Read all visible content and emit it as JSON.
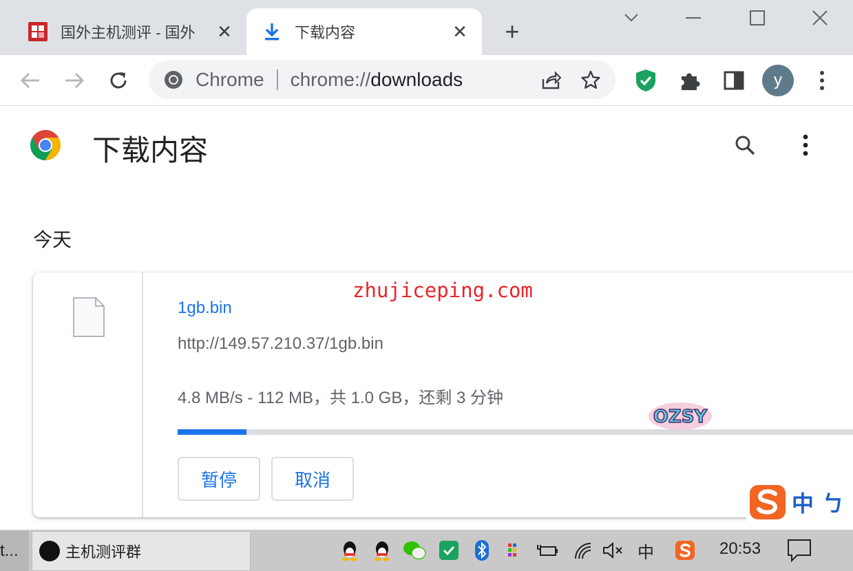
{
  "tabs": [
    {
      "title": "国外主机测评 - 国外",
      "close": "✕",
      "favicon": "zhujiceping-favicon"
    },
    {
      "title": "下载内容",
      "close": "✕",
      "favicon": "download-icon"
    }
  ],
  "new_tab_symbol": "+",
  "window_controls": [
    "tab-search-icon",
    "minimize-icon",
    "maximize-icon",
    "close-icon"
  ],
  "omnibox": {
    "scheme_label": "Chrome",
    "url_prefix": "chrome://",
    "url_host": "downloads"
  },
  "toolbar_icons": [
    "back-icon",
    "forward-icon",
    "reload-icon",
    "share-icon",
    "star-icon",
    "shield-extension-icon",
    "puzzle-extension-icon",
    "side-panel-icon",
    "menu-icon"
  ],
  "profile": {
    "initial": "y"
  },
  "page": {
    "title": "下载内容",
    "date_group": "今天"
  },
  "download": {
    "file_name": "1gb.bin",
    "url": "http://149.57.210.37/1gb.bin",
    "status": "4.8 MB/s - 112 MB，共 1.0 GB，还剩 3 分钟",
    "progress": 0.1,
    "pause_label": "暂停",
    "cancel_label": "取消"
  },
  "overlays": {
    "watermark": "zhujiceping.com",
    "sticker": "OZSY",
    "ime_mode": "中",
    "ime_punct": "ㄅ"
  },
  "taskbar": {
    "prev_label": "t...",
    "app_label": "主机测评群",
    "time": "20:53",
    "input_indicator": "中"
  },
  "colors": {
    "accent": "#1a73e8",
    "tabstrip": "#dee1e6",
    "watermark": "#e8252b",
    "shield": "#1aa260"
  }
}
